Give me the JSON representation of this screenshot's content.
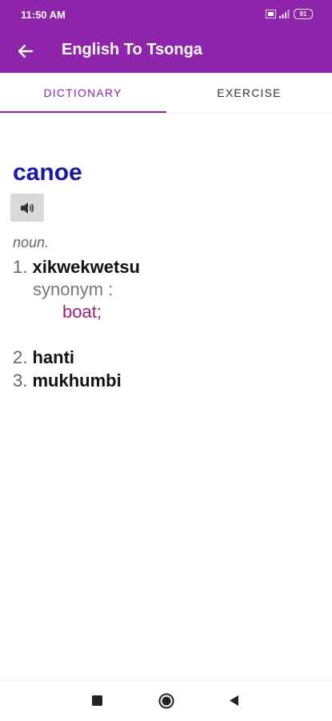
{
  "status_bar": {
    "time": "11:50 AM",
    "battery": "91"
  },
  "toolbar": {
    "title": "English To Tsonga"
  },
  "tabs": [
    {
      "label": "DICTIONARY",
      "selected": true
    },
    {
      "label": "EXERCISE",
      "selected": false
    }
  ],
  "entry": {
    "headword": "canoe",
    "part_of_speech": "noun.",
    "senses": [
      {
        "number": "1.",
        "word": "xikwekwetsu",
        "synonym_label": "synonym :",
        "synonym": "boat;"
      },
      {
        "number": "2.",
        "word": "hanti"
      },
      {
        "number": "3.",
        "word": "mukhumbi"
      }
    ]
  },
  "colors": {
    "primary": "#8e24aa",
    "headword": "#1a1aa0",
    "synonym": "#9c1b7e"
  },
  "icons": [
    "back-arrow-icon",
    "speaker-icon",
    "square-icon",
    "home-circle-icon",
    "back-triangle-icon"
  ]
}
